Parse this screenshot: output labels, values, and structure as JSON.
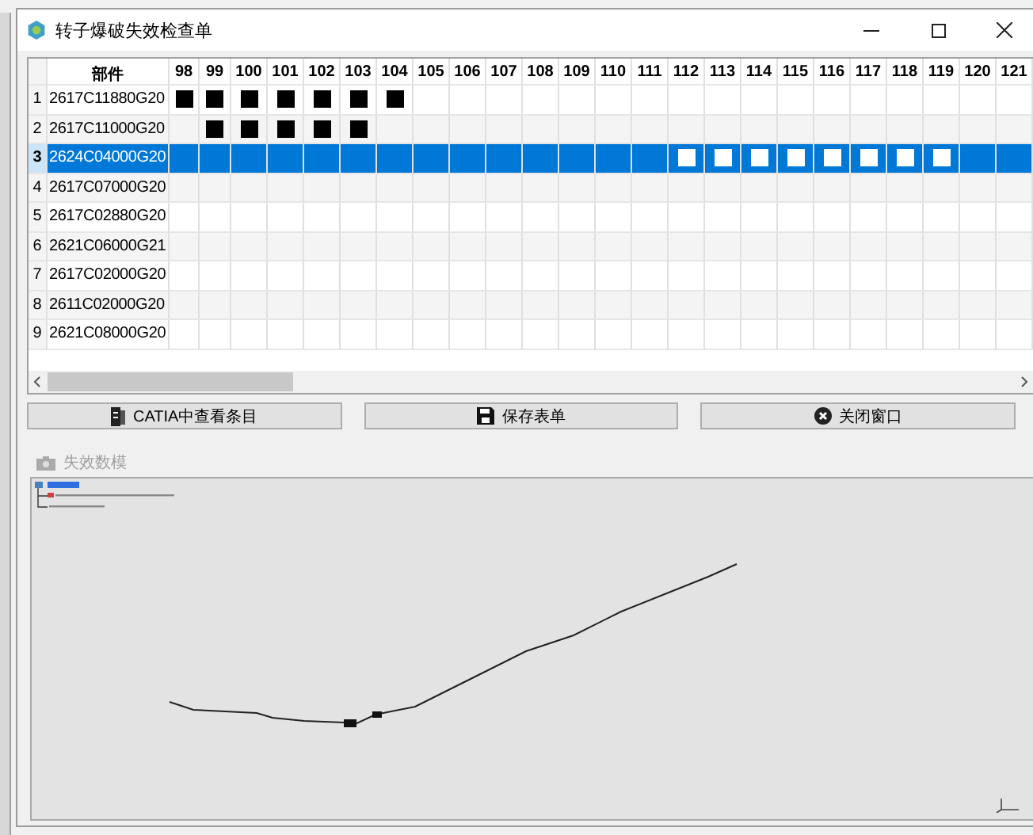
{
  "window": {
    "title": "转子爆破失效检查单"
  },
  "table": {
    "columns": [
      "部件",
      "98",
      "99",
      "100",
      "101",
      "102",
      "103",
      "104",
      "105",
      "106",
      "107",
      "108",
      "109",
      "110",
      "111",
      "112",
      "113",
      "114",
      "115",
      "116",
      "117",
      "118",
      "119",
      "120",
      "121"
    ],
    "rows": [
      {
        "index": "1",
        "part": "2617C11880G20",
        "selected": false,
        "marked": [
          true,
          true,
          true,
          true,
          true,
          true,
          true,
          false,
          false,
          false,
          false,
          false,
          false,
          false,
          false,
          false,
          false,
          false,
          false,
          false,
          false,
          false,
          false,
          false
        ]
      },
      {
        "index": "2",
        "part": "2617C11000G20",
        "selected": false,
        "marked": [
          false,
          true,
          true,
          true,
          true,
          true,
          false,
          false,
          false,
          false,
          false,
          false,
          false,
          false,
          false,
          false,
          false,
          false,
          false,
          false,
          false,
          false,
          false,
          false
        ]
      },
      {
        "index": "3",
        "part": "2624C04000G20",
        "selected": true,
        "marked": [
          false,
          false,
          false,
          false,
          false,
          false,
          false,
          false,
          false,
          false,
          false,
          false,
          false,
          false,
          true,
          true,
          true,
          true,
          true,
          true,
          true,
          true,
          false,
          false
        ]
      },
      {
        "index": "4",
        "part": "2617C07000G20",
        "selected": false,
        "marked": [
          false,
          false,
          false,
          false,
          false,
          false,
          false,
          false,
          false,
          false,
          false,
          false,
          false,
          false,
          false,
          false,
          false,
          false,
          false,
          false,
          false,
          false,
          false,
          false
        ]
      },
      {
        "index": "5",
        "part": "2617C02880G20",
        "selected": false,
        "marked": [
          false,
          false,
          false,
          false,
          false,
          false,
          false,
          false,
          false,
          false,
          false,
          false,
          false,
          false,
          false,
          false,
          false,
          false,
          false,
          false,
          false,
          false,
          false,
          false
        ]
      },
      {
        "index": "6",
        "part": "2621C06000G21",
        "selected": false,
        "marked": [
          false,
          false,
          false,
          false,
          false,
          false,
          false,
          false,
          false,
          false,
          false,
          false,
          false,
          false,
          false,
          false,
          false,
          false,
          false,
          false,
          false,
          false,
          false,
          false
        ]
      },
      {
        "index": "7",
        "part": "2617C02000G20",
        "selected": false,
        "marked": [
          false,
          false,
          false,
          false,
          false,
          false,
          false,
          false,
          false,
          false,
          false,
          false,
          false,
          false,
          false,
          false,
          false,
          false,
          false,
          false,
          false,
          false,
          false,
          false
        ]
      },
      {
        "index": "8",
        "part": "2611C02000G20",
        "selected": false,
        "marked": [
          false,
          false,
          false,
          false,
          false,
          false,
          false,
          false,
          false,
          false,
          false,
          false,
          false,
          false,
          false,
          false,
          false,
          false,
          false,
          false,
          false,
          false,
          false,
          false
        ]
      },
      {
        "index": "9",
        "part": "2621C08000G20",
        "selected": false,
        "marked": [
          false,
          false,
          false,
          false,
          false,
          false,
          false,
          false,
          false,
          false,
          false,
          false,
          false,
          false,
          false,
          false,
          false,
          false,
          false,
          false,
          false,
          false,
          false,
          false
        ]
      }
    ]
  },
  "buttons": [
    {
      "kind": "catia",
      "label": "CATIA中查看条目"
    },
    {
      "kind": "save",
      "label": "保存表单"
    },
    {
      "kind": "close",
      "label": "关闭窗口"
    }
  ],
  "group": {
    "title": "失效数模"
  }
}
